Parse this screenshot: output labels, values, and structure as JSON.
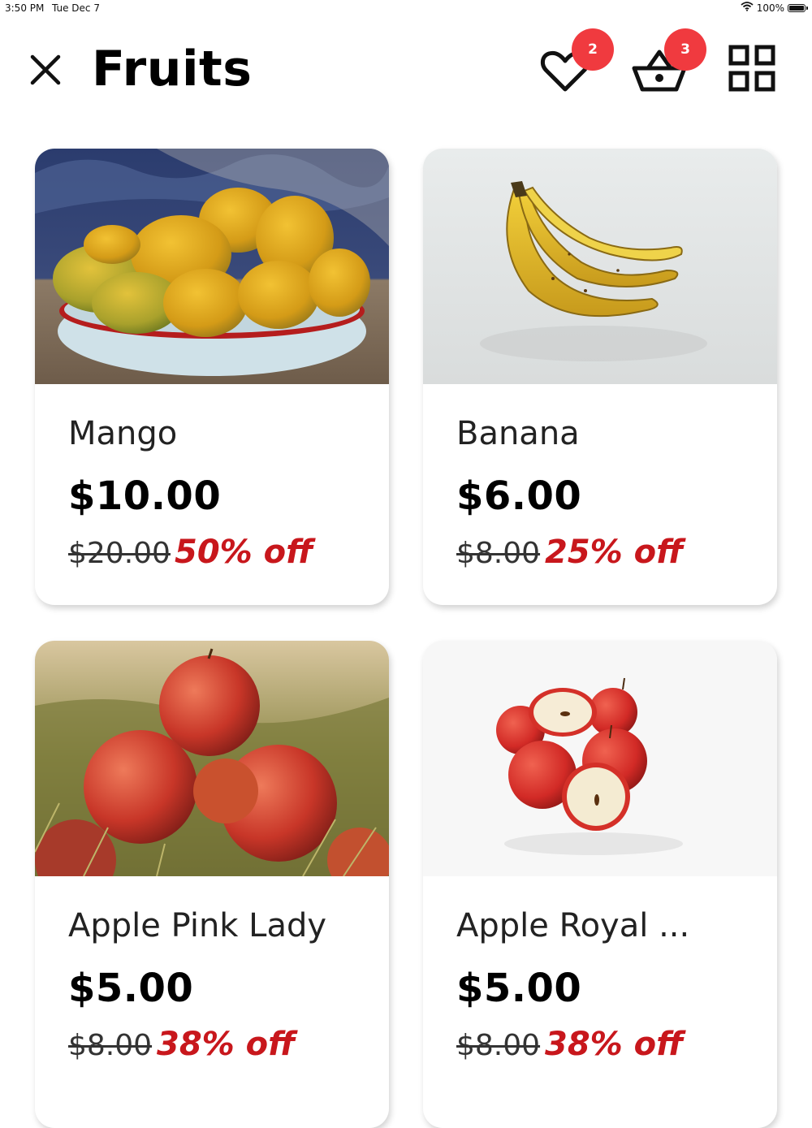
{
  "status_bar": {
    "time": "3:50 PM",
    "date": "Tue Dec 7",
    "battery": "100%"
  },
  "header": {
    "title": "Fruits",
    "favorites_count": "2",
    "cart_count": "3"
  },
  "colors": {
    "badge": "#f03a3f",
    "discount": "#c8171c",
    "text": "#000000"
  },
  "products": [
    {
      "name": "Mango",
      "price": "$10.00",
      "original_price": "$20.00",
      "discount": "50% off",
      "image": "mangoes-in-bowl"
    },
    {
      "name": "Banana",
      "price": "$6.00",
      "original_price": "$8.00",
      "discount": "25% off",
      "image": "banana-bunch"
    },
    {
      "name": "Apple Pink Lady",
      "price": "$5.00",
      "original_price": "$8.00",
      "discount": "38% off",
      "image": "apples-on-grass"
    },
    {
      "name": "Apple Royal ...",
      "price": "$5.00",
      "original_price": "$8.00",
      "discount": "38% off",
      "image": "apples-halved"
    }
  ]
}
